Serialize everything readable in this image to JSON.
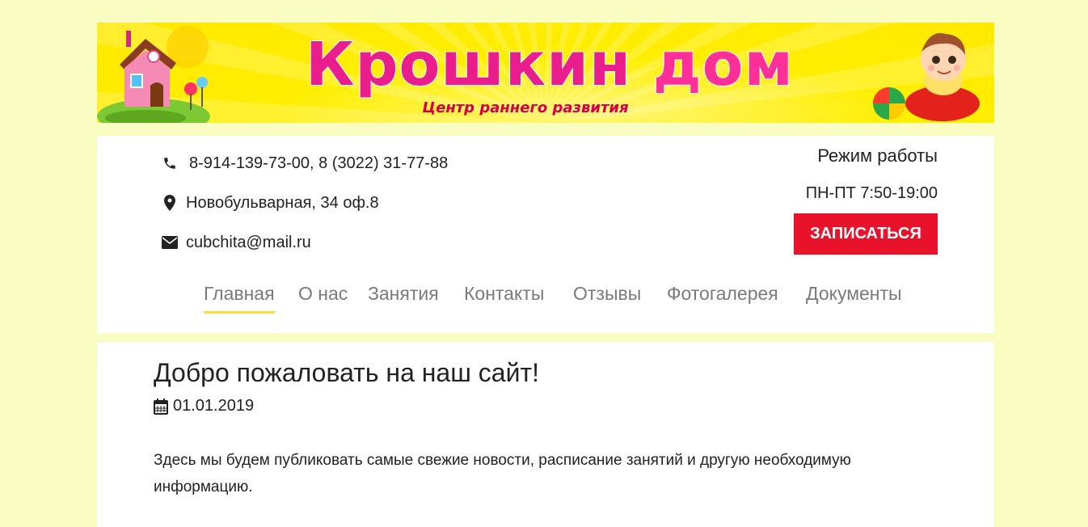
{
  "banner": {
    "title_parts": [
      "Крошкин",
      " ",
      "дом"
    ],
    "subtitle": "Центр раннего развития",
    "logo_icon": "house-icon",
    "mascot_icon": "baby-icon"
  },
  "contacts": {
    "phone": "8-914-139-73-00, 8 (3022) 31-77-88",
    "address": "Новобульварная, 34 оф.8",
    "email": "cubchita@mail.ru"
  },
  "schedule": {
    "title": "Режим работы",
    "hours": "ПН-ПТ 7:50-19:00"
  },
  "signup_label": "ЗАПИСАТЬСЯ",
  "nav": {
    "items": [
      {
        "label": "Главная",
        "active": true
      },
      {
        "label": "О нас"
      },
      {
        "label": "Занятия"
      },
      {
        "label": "Контакты"
      },
      {
        "label": "Отзывы"
      },
      {
        "label": "Фотогалерея"
      },
      {
        "label": "Документы"
      }
    ]
  },
  "post": {
    "title": "Добро пожаловать на наш сайт!",
    "date": "01.01.2019",
    "body": "Здесь мы будем публиковать самые свежие новости, расписание занятий и другую необходимую информацию."
  },
  "colors": {
    "page_bg": "#fafdc2",
    "banner_bg": "#ffee00",
    "accent": "#e8122a",
    "nav_underline": "#f6df3a",
    "nav_text": "#7a7a7a"
  }
}
